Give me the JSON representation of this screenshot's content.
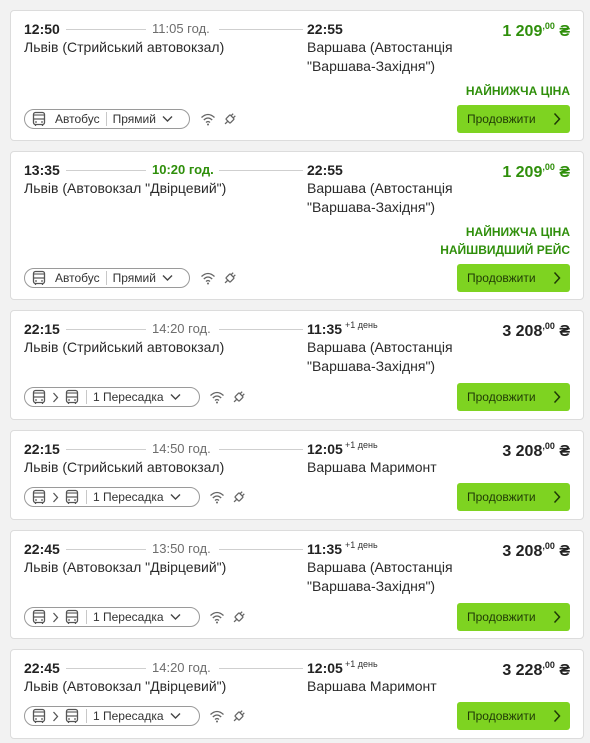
{
  "results": [
    {
      "departure_time": "12:50",
      "duration": "11:05 год.",
      "duration_fastest": false,
      "arrival_time": "22:55",
      "next_day": "",
      "from": "Львів (Стрийський автовокзал)",
      "to_line1": "Варшава (Автостанція",
      "to_line2": "\"Варшава-Західня\")",
      "price_main": "1 209",
      "price_cents": ",00",
      "currency": "₴",
      "price_best": true,
      "badges": [
        "НАЙНИЖЧА ЦІНА"
      ],
      "transfer_type": "direct",
      "transport_label": "Автобус",
      "route_label": "Прямий",
      "continue_label": "Продовжити"
    },
    {
      "departure_time": "13:35",
      "duration": "10:20 год.",
      "duration_fastest": true,
      "arrival_time": "22:55",
      "next_day": "",
      "from": "Львів (Автовокзал \"Двірцевий\")",
      "to_line1": "Варшава (Автостанція",
      "to_line2": "\"Варшава-Західня\")",
      "price_main": "1 209",
      "price_cents": ",00",
      "currency": "₴",
      "price_best": true,
      "badges": [
        "НАЙНИЖЧА ЦІНА",
        "НАЙШВИДШИЙ РЕЙС"
      ],
      "transfer_type": "direct",
      "transport_label": "Автобус",
      "route_label": "Прямий",
      "continue_label": "Продовжити"
    },
    {
      "departure_time": "22:15",
      "duration": "14:20 год.",
      "duration_fastest": false,
      "arrival_time": "11:35",
      "next_day": "+1 день",
      "from": "Львів (Стрийський автовокзал)",
      "to_line1": "Варшава (Автостанція",
      "to_line2": "\"Варшава-Західня\")",
      "price_main": "3 208",
      "price_cents": ",00",
      "currency": "₴",
      "price_best": false,
      "badges": [],
      "transfer_type": "transfer",
      "route_label": "1 Пересадка",
      "continue_label": "Продовжити"
    },
    {
      "departure_time": "22:15",
      "duration": "14:50 год.",
      "duration_fastest": false,
      "arrival_time": "12:05",
      "next_day": "+1 день",
      "from": "Львів (Стрийський автовокзал)",
      "to_line1": "Варшава Маримонт",
      "to_line2": "",
      "price_main": "3 208",
      "price_cents": ",00",
      "currency": "₴",
      "price_best": false,
      "badges": [],
      "transfer_type": "transfer",
      "route_label": "1 Пересадка",
      "continue_label": "Продовжити"
    },
    {
      "departure_time": "22:45",
      "duration": "13:50 год.",
      "duration_fastest": false,
      "arrival_time": "11:35",
      "next_day": "+1 день",
      "from": "Львів (Автовокзал \"Двірцевий\")",
      "to_line1": "Варшава (Автостанція",
      "to_line2": "\"Варшава-Західня\")",
      "price_main": "3 208",
      "price_cents": ",00",
      "currency": "₴",
      "price_best": false,
      "badges": [],
      "transfer_type": "transfer",
      "route_label": "1 Пересадка",
      "continue_label": "Продовжити"
    },
    {
      "departure_time": "22:45",
      "duration": "14:20 год.",
      "duration_fastest": false,
      "arrival_time": "12:05",
      "next_day": "+1 день",
      "from": "Львів (Автовокзал \"Двірцевий\")",
      "to_line1": "Варшава Маримонт",
      "to_line2": "",
      "price_main": "3 228",
      "price_cents": ",00",
      "currency": "₴",
      "price_best": false,
      "badges": [],
      "transfer_type": "transfer",
      "route_label": "1 Пересадка",
      "continue_label": "Продовжити"
    }
  ],
  "icons": {
    "bus": "bus-icon",
    "wifi": "wifi-icon",
    "power": "power-plug-icon",
    "chevron": "chevron-down-icon",
    "arrow": "chevron-right-icon"
  },
  "colors": {
    "accent_green": "#7ed321",
    "best_price_green": "#2f8f0b"
  }
}
